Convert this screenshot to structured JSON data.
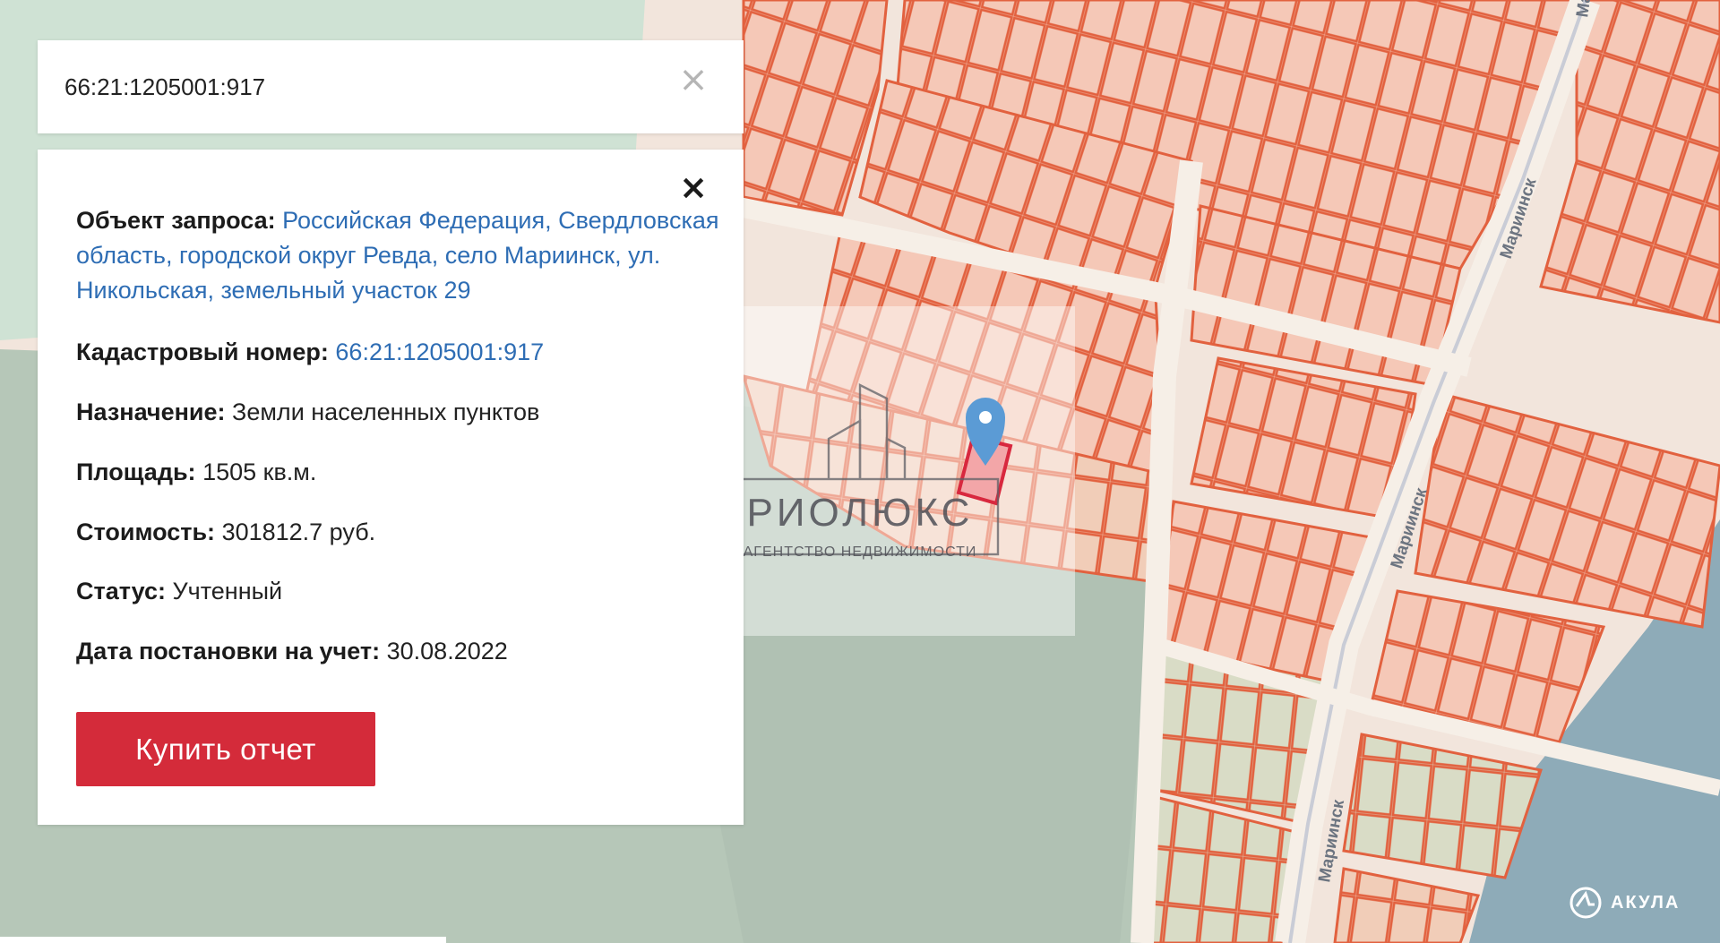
{
  "search": {
    "value": "66:21:1205001:917",
    "clear_icon": "close-icon"
  },
  "card": {
    "close_icon": "close-icon",
    "object_label": "Объект запроса:",
    "object_value": "Российская Федерация, Свердловская область, городской округ Ревда, село Мариинск, ул. Никольская, земельный участок 29",
    "cadastral_label": "Кадастровый номер:",
    "cadastral_value": "66:21:1205001:917",
    "purpose_label": "Назначение:",
    "purpose_value": "Земли населенных пунктов",
    "area_label": "Площадь:",
    "area_value": "1505 кв.м.",
    "cost_label": "Стоимость:",
    "cost_value": "301812.7 руб.",
    "status_label": "Статус:",
    "status_value": "Учтенный",
    "date_label": "Дата постановки на учет:",
    "date_value": "30.08.2022",
    "buy_button": "Купить отчет"
  },
  "map": {
    "street_labels": [
      "Мариинск",
      "Мариинск",
      "Мариинск",
      "Мариинск"
    ],
    "marker_icon": "map-pin-icon",
    "watermark_name": "РИОЛЮКС",
    "watermark_tagline": "АГЕНТСТВО НЕДВИЖИМОСТИ",
    "brand": "АКУЛА"
  },
  "colors": {
    "parcel_line": "#e46a4a",
    "parcel_fill": "#f6c6b4",
    "link": "#2e6db4",
    "button": "#d42b3a",
    "water": "#8eabb8",
    "vegetation": "#b6c7b8",
    "marker": "#5b9bd5"
  }
}
